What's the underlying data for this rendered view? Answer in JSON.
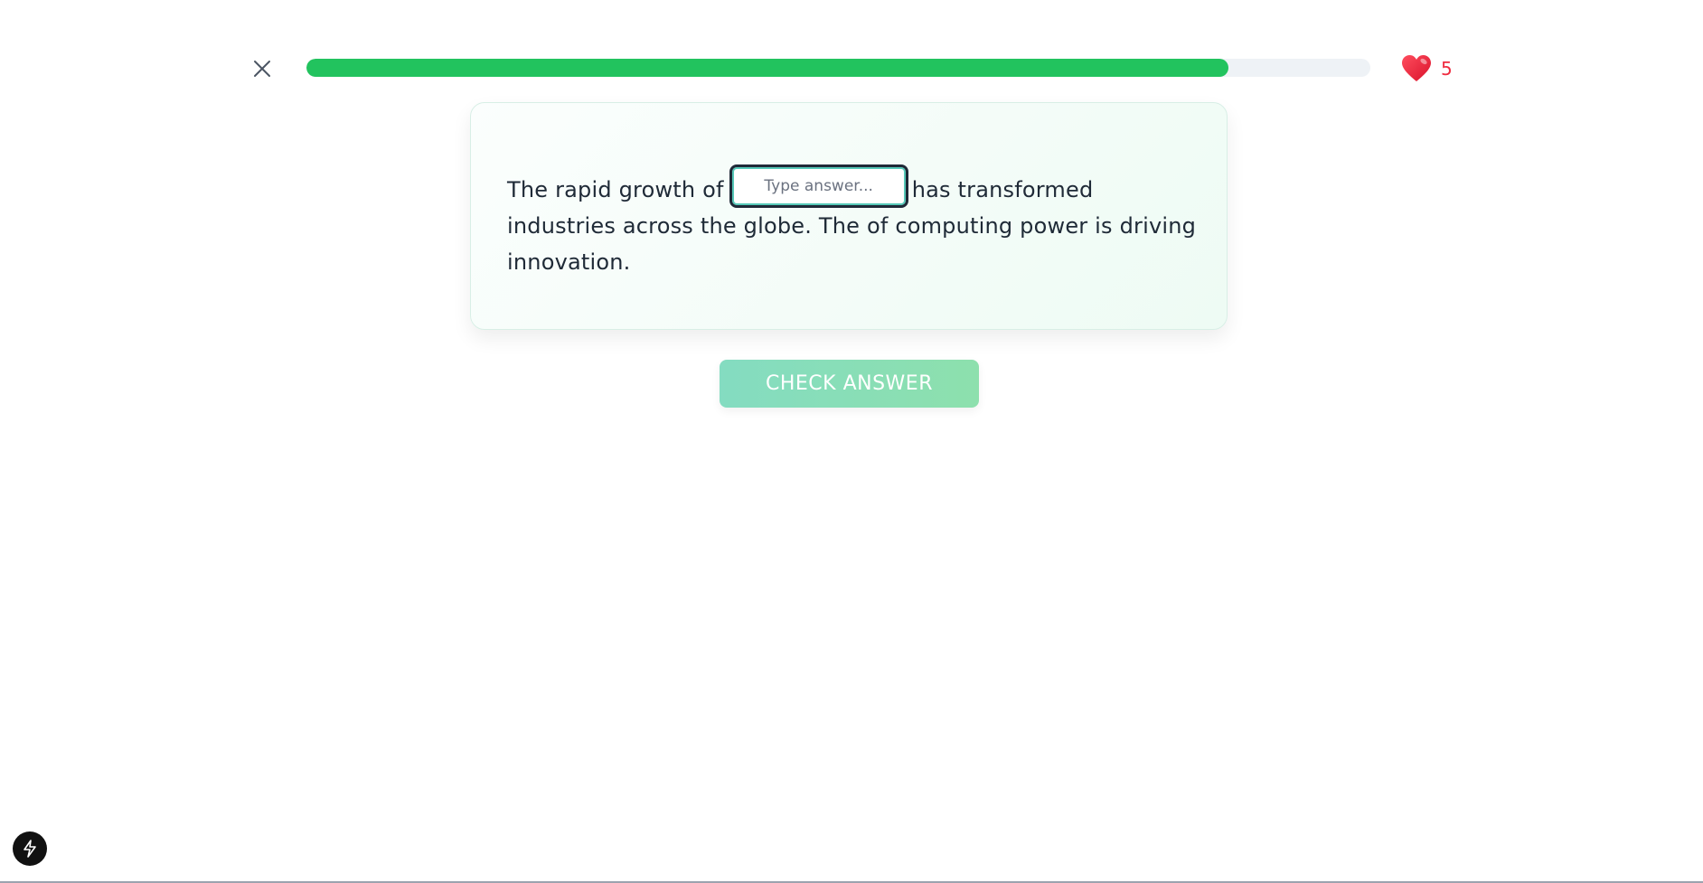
{
  "header": {
    "close_icon": "close-icon",
    "progress_fraction": 0.867,
    "progress_color": "#22c35e",
    "track_color": "#eef2f6",
    "hearts_icon": "heart-icon",
    "hearts_count": "5",
    "hearts_color": "#ef2b3f"
  },
  "exercise": {
    "text_before": "The rapid growth of",
    "input_placeholder": "Type answer...",
    "input_value": "",
    "text_after": "has transformed industries across the globe. The of computing power is driving innovation."
  },
  "actions": {
    "check_label": "CHECK ANSWER"
  },
  "footer": {
    "badge_icon": "lightning-icon"
  }
}
